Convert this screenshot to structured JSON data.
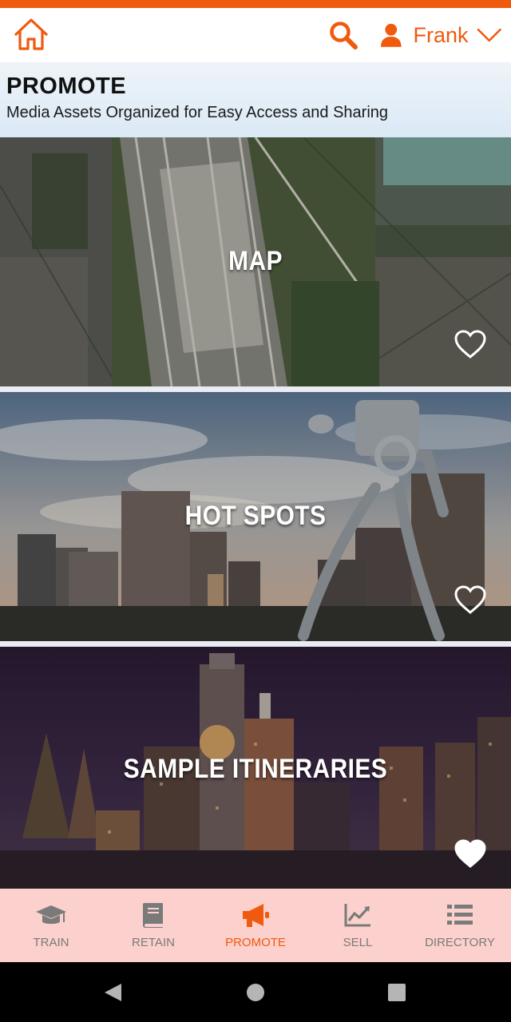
{
  "colors": {
    "accent": "#f05a0e",
    "nav_background": "#fcd0cc",
    "nav_inactive": "#7a7a7a",
    "header_background": "#dbe9f6"
  },
  "top_bar": {
    "home_icon": "home-icon",
    "search_icon": "search-icon",
    "user": {
      "icon": "user-icon",
      "name": "Frank",
      "dropdown_icon": "chevron-down-icon"
    }
  },
  "header": {
    "title": "PROMOTE",
    "subtitle": "Media Assets Organized for Easy Access and Sharing"
  },
  "cards": [
    {
      "label": "MAP",
      "favorite": false,
      "image": "aerial-airport-photo"
    },
    {
      "label": "HOT SPOTS",
      "favorite": false,
      "image": "city-skyline-sculpture-photo"
    },
    {
      "label": "SAMPLE ITINERARIES",
      "favorite": true,
      "image": "night-skyline-photo"
    }
  ],
  "bottom_nav": {
    "active": "PROMOTE",
    "items": [
      {
        "label": "TRAIN",
        "icon": "graduation-cap-icon"
      },
      {
        "label": "RETAIN",
        "icon": "book-icon"
      },
      {
        "label": "PROMOTE",
        "icon": "megaphone-icon"
      },
      {
        "label": "SELL",
        "icon": "line-chart-icon"
      },
      {
        "label": "DIRECTORY",
        "icon": "list-icon"
      }
    ]
  },
  "system_nav": {
    "back": "back-icon",
    "home": "home-circle-icon",
    "recents": "recents-icon"
  }
}
